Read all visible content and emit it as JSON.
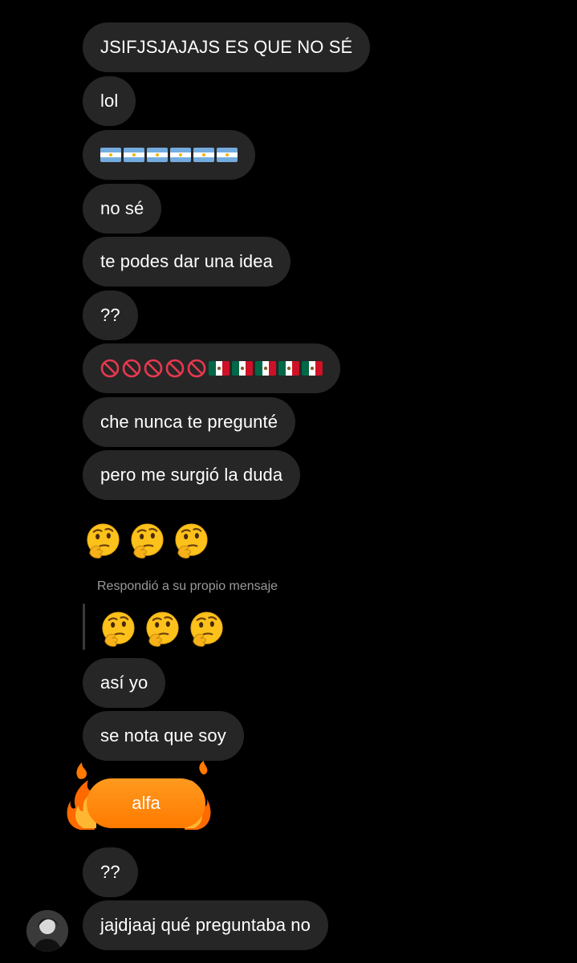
{
  "conversation": {
    "messages": [
      {
        "text": "JSIFJSJAJAJS ES QUE NO SÉ"
      },
      {
        "text": "lol"
      },
      {
        "text": "no sé"
      },
      {
        "text": "te podes dar una idea"
      },
      {
        "text": "??"
      },
      {
        "text": "che nunca te pregunté"
      },
      {
        "text": "pero me surgió la duda"
      },
      {
        "text": "así yo"
      },
      {
        "text": "se nota que soy"
      },
      {
        "text": "alfa"
      },
      {
        "text": "??"
      },
      {
        "text": "jajdjaaj qué preguntaba no"
      }
    ],
    "reply_label": "Respondió a su propio mensaje"
  },
  "emoji": {
    "flag_argentina_count": 6,
    "prohibited_count": 5,
    "flag_mexico_count": 5,
    "thinking_face_count": 3
  },
  "colors": {
    "background": "#000000",
    "bubble": "#262626",
    "fire_bubble": "#ff8a00",
    "reply_label": "#9a9a9a"
  }
}
